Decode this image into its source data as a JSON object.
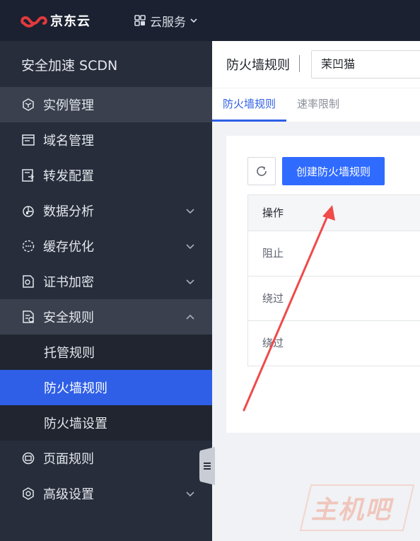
{
  "topbar": {
    "brand_name": "京东云",
    "cloud_services_label": "云服务",
    "brand_color": "#e4393c"
  },
  "sidebar": {
    "title": "安全加速 SCDN",
    "items": [
      {
        "label": "实例管理",
        "icon": "cube-icon"
      },
      {
        "label": "域名管理",
        "icon": "browser-icon"
      },
      {
        "label": "转发配置",
        "icon": "forward-config-icon"
      },
      {
        "label": "数据分析",
        "icon": "chart-icon"
      },
      {
        "label": "缓存优化",
        "icon": "cache-icon"
      },
      {
        "label": "证书加密",
        "icon": "certificate-icon"
      },
      {
        "label": "安全规则",
        "icon": "security-doc-icon"
      },
      {
        "label": "页面规则",
        "icon": "page-rule-icon"
      },
      {
        "label": "高级设置",
        "icon": "advanced-settings-icon"
      }
    ],
    "sub_items": [
      {
        "label": "托管规则"
      },
      {
        "label": "防火墙规则"
      },
      {
        "label": "防火墙设置"
      }
    ]
  },
  "header": {
    "title": "防火墙规则",
    "domain_value": "茉凹猫"
  },
  "tabs": [
    {
      "label": "防火墙规则"
    },
    {
      "label": "速率限制"
    }
  ],
  "toolbar": {
    "create_label": "创建防火墙规则"
  },
  "table": {
    "header": "操作",
    "rows": [
      "阻止",
      "绕过",
      "绕过"
    ]
  },
  "watermark": {
    "text": "主机吧"
  },
  "colors": {
    "accent": "#2f6bff",
    "sidebar_active": "#2f5fe6",
    "annotation_arrow": "#f04a4a"
  }
}
